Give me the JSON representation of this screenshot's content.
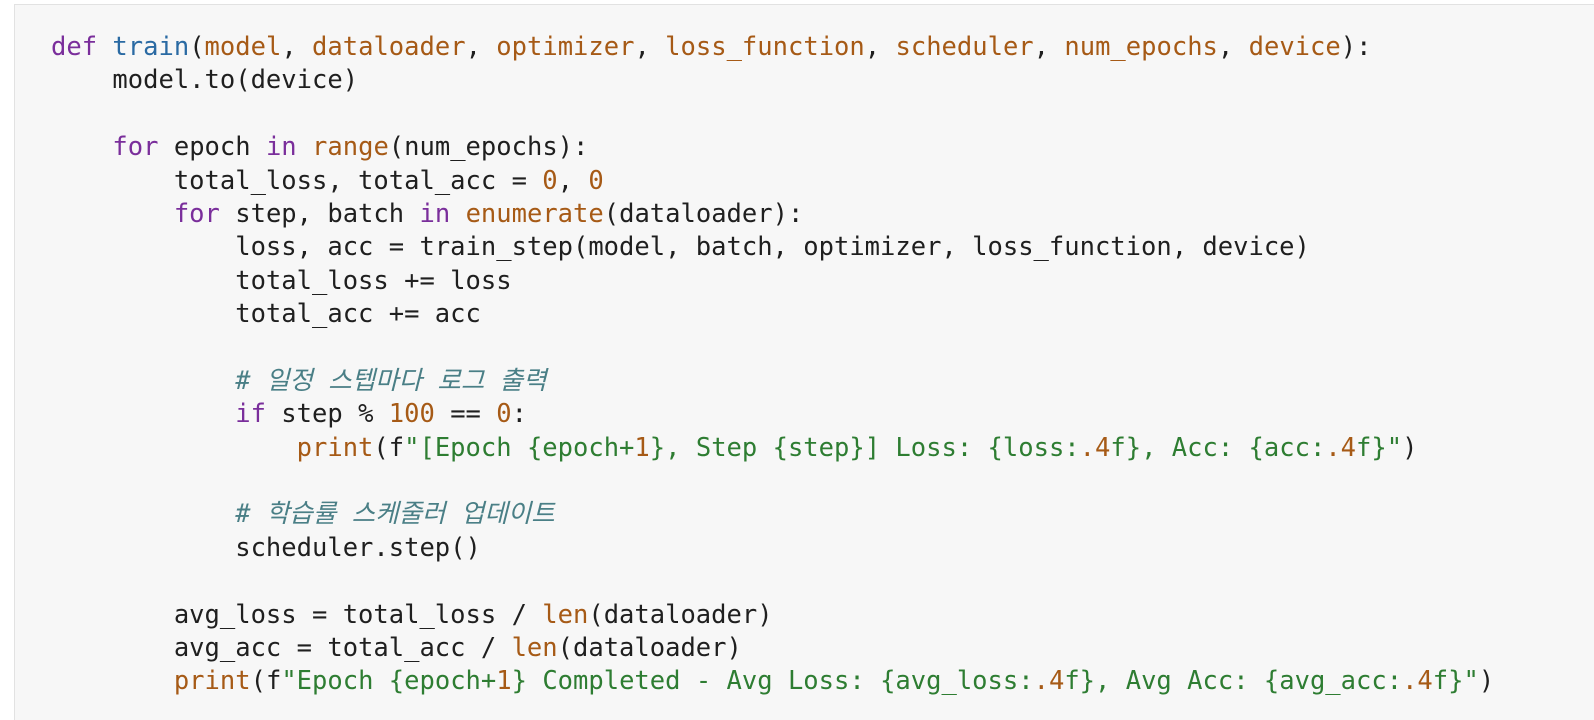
{
  "code": {
    "lines": [
      [
        {
          "t": "def",
          "c": "kw"
        },
        {
          "t": " ",
          "c": "txt"
        },
        {
          "t": "train",
          "c": "fn"
        },
        {
          "t": "(",
          "c": "txt"
        },
        {
          "t": "model",
          "c": "prm"
        },
        {
          "t": ", ",
          "c": "txt"
        },
        {
          "t": "dataloader",
          "c": "prm"
        },
        {
          "t": ", ",
          "c": "txt"
        },
        {
          "t": "optimizer",
          "c": "prm"
        },
        {
          "t": ", ",
          "c": "txt"
        },
        {
          "t": "loss_function",
          "c": "prm"
        },
        {
          "t": ", ",
          "c": "txt"
        },
        {
          "t": "scheduler",
          "c": "prm"
        },
        {
          "t": ", ",
          "c": "txt"
        },
        {
          "t": "num_epochs",
          "c": "prm"
        },
        {
          "t": ", ",
          "c": "txt"
        },
        {
          "t": "device",
          "c": "prm"
        },
        {
          "t": "):",
          "c": "txt"
        }
      ],
      [
        {
          "t": "    model.to(device)",
          "c": "txt"
        }
      ],
      [],
      [
        {
          "t": "    ",
          "c": "txt"
        },
        {
          "t": "for",
          "c": "kw"
        },
        {
          "t": " epoch ",
          "c": "txt"
        },
        {
          "t": "in",
          "c": "kw"
        },
        {
          "t": " ",
          "c": "txt"
        },
        {
          "t": "range",
          "c": "bi"
        },
        {
          "t": "(num_epochs):",
          "c": "txt"
        }
      ],
      [
        {
          "t": "        total_loss, total_acc = ",
          "c": "txt"
        },
        {
          "t": "0",
          "c": "num"
        },
        {
          "t": ", ",
          "c": "txt"
        },
        {
          "t": "0",
          "c": "num"
        }
      ],
      [
        {
          "t": "        ",
          "c": "txt"
        },
        {
          "t": "for",
          "c": "kw"
        },
        {
          "t": " step, batch ",
          "c": "txt"
        },
        {
          "t": "in",
          "c": "kw"
        },
        {
          "t": " ",
          "c": "txt"
        },
        {
          "t": "enumerate",
          "c": "bi"
        },
        {
          "t": "(dataloader):",
          "c": "txt"
        }
      ],
      [
        {
          "t": "            loss, acc = train_step(model, batch, optimizer, loss_function, device)",
          "c": "txt"
        }
      ],
      [
        {
          "t": "            total_loss += loss",
          "c": "txt"
        }
      ],
      [
        {
          "t": "            total_acc += acc",
          "c": "txt"
        }
      ],
      [],
      [
        {
          "t": "            ",
          "c": "txt"
        },
        {
          "t": "# 일정 스텝마다 로그 출력",
          "c": "cmt"
        }
      ],
      [
        {
          "t": "            ",
          "c": "txt"
        },
        {
          "t": "if",
          "c": "kw"
        },
        {
          "t": " step % ",
          "c": "txt"
        },
        {
          "t": "100",
          "c": "num"
        },
        {
          "t": " == ",
          "c": "txt"
        },
        {
          "t": "0",
          "c": "num"
        },
        {
          "t": ":",
          "c": "txt"
        }
      ],
      [
        {
          "t": "                ",
          "c": "txt"
        },
        {
          "t": "print",
          "c": "bi"
        },
        {
          "t": "(f",
          "c": "txt"
        },
        {
          "t": "\"[Epoch {epoch+",
          "c": "str"
        },
        {
          "t": "1",
          "c": "num"
        },
        {
          "t": "}, Step {step}] Loss: {loss:",
          "c": "str"
        },
        {
          "t": ".4",
          "c": "num"
        },
        {
          "t": "f}, Acc: {acc:",
          "c": "str"
        },
        {
          "t": ".4",
          "c": "num"
        },
        {
          "t": "f}\"",
          "c": "str"
        },
        {
          "t": ")",
          "c": "txt"
        }
      ],
      [],
      [
        {
          "t": "            ",
          "c": "txt"
        },
        {
          "t": "# 학습률 스케줄러 업데이트",
          "c": "cmt"
        }
      ],
      [
        {
          "t": "            scheduler.step()",
          "c": "txt"
        }
      ],
      [],
      [
        {
          "t": "        avg_loss = total_loss / ",
          "c": "txt"
        },
        {
          "t": "len",
          "c": "bi"
        },
        {
          "t": "(dataloader)",
          "c": "txt"
        }
      ],
      [
        {
          "t": "        avg_acc = total_acc / ",
          "c": "txt"
        },
        {
          "t": "len",
          "c": "bi"
        },
        {
          "t": "(dataloader)",
          "c": "txt"
        }
      ],
      [
        {
          "t": "        ",
          "c": "txt"
        },
        {
          "t": "print",
          "c": "bi"
        },
        {
          "t": "(f",
          "c": "txt"
        },
        {
          "t": "\"Epoch {epoch+",
          "c": "str"
        },
        {
          "t": "1",
          "c": "num"
        },
        {
          "t": "} Completed - Avg Loss: {avg_loss:",
          "c": "str"
        },
        {
          "t": ".4",
          "c": "num"
        },
        {
          "t": "f}, Avg Acc: {avg_acc:",
          "c": "str"
        },
        {
          "t": ".4",
          "c": "num"
        },
        {
          "t": "f}\"",
          "c": "str"
        },
        {
          "t": ")",
          "c": "txt"
        }
      ]
    ]
  }
}
